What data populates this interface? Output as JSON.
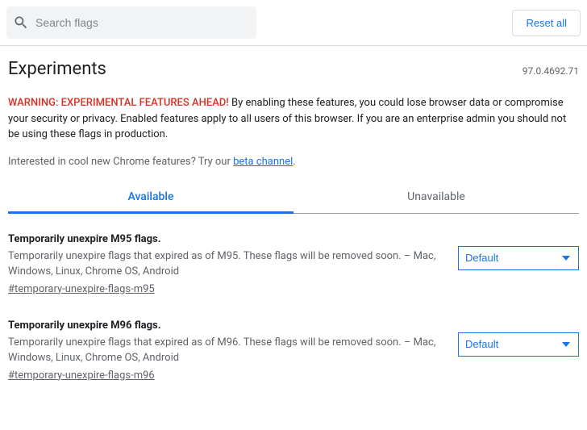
{
  "search": {
    "placeholder": "Search flags"
  },
  "reset_label": "Reset all",
  "title": "Experiments",
  "version": "97.0.4692.71",
  "warning_prefix": "WARNING: EXPERIMENTAL FEATURES AHEAD!",
  "warning_body": " By enabling these features, you could lose browser data or compromise your security or privacy. Enabled features apply to all users of this browser. If you are an enterprise admin you should not be using these flags in production.",
  "beta_prefix": "Interested in cool new Chrome features? Try our ",
  "beta_link_text": "beta channel",
  "beta_suffix": ".",
  "tabs": {
    "available": "Available",
    "unavailable": "Unavailable"
  },
  "flags": [
    {
      "title": "Temporarily unexpire M95 flags.",
      "desc": "Temporarily unexpire flags that expired as of M95. These flags will be removed soon. – Mac, Windows, Linux, Chrome OS, Android",
      "hash": "#temporary-unexpire-flags-m95",
      "selected": "Default"
    },
    {
      "title": "Temporarily unexpire M96 flags.",
      "desc": "Temporarily unexpire flags that expired as of M96. These flags will be removed soon. – Mac, Windows, Linux, Chrome OS, Android",
      "hash": "#temporary-unexpire-flags-m96",
      "selected": "Default"
    }
  ]
}
